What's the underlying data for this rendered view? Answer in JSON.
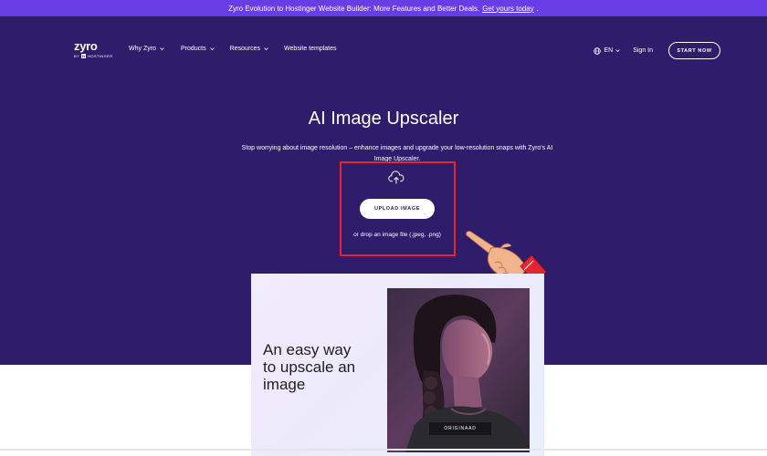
{
  "banner": {
    "text": "Zyro Evolution to Hostinger Website Builder: More Features and Better Deals.",
    "link": "Get yours today",
    "suffix": "."
  },
  "header": {
    "logo": {
      "word": "zyro",
      "by": "BY",
      "company": "HOSTINGER"
    },
    "nav": [
      {
        "label": "Why Zyro",
        "has_dropdown": true
      },
      {
        "label": "Products",
        "has_dropdown": true
      },
      {
        "label": "Resources",
        "has_dropdown": true
      },
      {
        "label": "Website templates",
        "has_dropdown": false
      }
    ],
    "language": "EN",
    "signin": "Sign In",
    "start_button": "START NOW"
  },
  "hero": {
    "title": "AI Image Upscaler",
    "subtitle": "Stop worrying about image resolution – enhance images and upgrade your low-resolution snaps with Zyro's AI Image Upscaler.",
    "upload_button": "UPLOAD IMAGE",
    "drop_text": "or drop an image file (.jpeg, .png)"
  },
  "preview": {
    "heading": "An easy way to upscale an image",
    "tag": "ORIGINAAD"
  },
  "colors": {
    "banner": "#673de6",
    "hero_bg": "#2f1c6a",
    "highlight": "#e3262f"
  },
  "icons": [
    "upload-cloud-icon",
    "globe-icon",
    "chevron-down-icon",
    "pointing-hand-icon"
  ]
}
